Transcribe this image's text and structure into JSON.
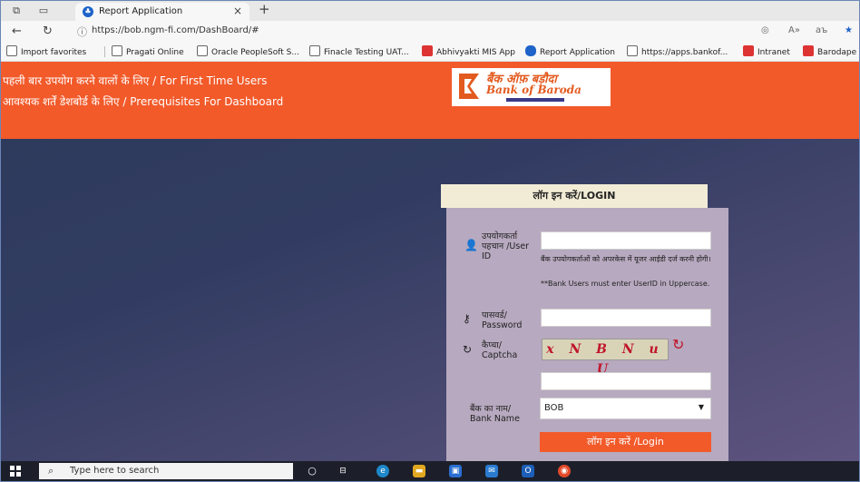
{
  "browser": {
    "tab_title": "Report Application",
    "tab_close": "×",
    "new_tab": "+",
    "url": "https://bob.ngm-fi.com/DashBoard/#",
    "favorites": [
      "Import favorites",
      "Pragati Online",
      "Oracle PeopleSoft S...",
      "Finacle Testing UAT...",
      "Abhivyakti MIS App",
      "Report Application",
      "https://apps.bankof...",
      "Intranet",
      "Barodape"
    ]
  },
  "header": {
    "link1": "पहली बार उपयोग करने वालों के लिए / For First Time Users",
    "link2": "आवश्यक शर्तें डेशबोर्ड के लिए / Prerequisites For Dashboard",
    "logo_hindi": "बैंक ऑफ़ बड़ौदा",
    "logo_english": "Bank of Baroda",
    "accent": "#f25a2a"
  },
  "login": {
    "heading": "लॉग इन करें/LOGIN",
    "user_label": "उपयोगकर्ता पहचान /User ID",
    "user_note_hindi": "बैंक उपयोगकर्ताओं को अपरकेस में यूजर आईडी दर्ज करनी होगी।",
    "user_note_english": "**Bank Users must enter UserID in Uppercase.",
    "password_label": "पासवर्ड/ Password",
    "captcha_label": "कैप्चा/ Captcha",
    "captcha_text": "x N B N u U",
    "bank_label": "बैंक का नाम/ Bank Name",
    "bank_selected": "BOB",
    "button": "लॉग इन करें /Login"
  },
  "taskbar": {
    "search_placeholder": "Type here to search"
  }
}
